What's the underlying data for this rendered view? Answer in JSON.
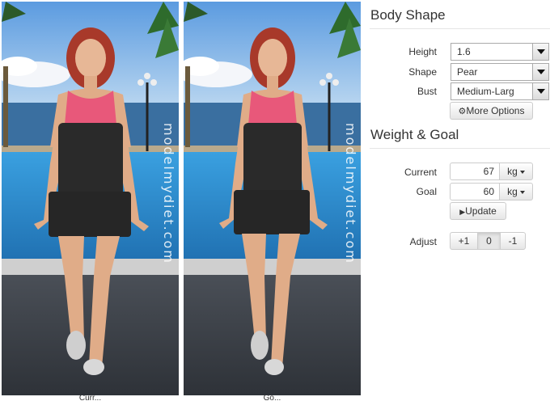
{
  "models": {
    "current": {
      "caption": "Curr...",
      "watermark": "modelmydiet.com"
    },
    "goal": {
      "caption": "Go...",
      "watermark": "modelmydiet.com"
    }
  },
  "body_shape": {
    "title": "Body Shape",
    "height": {
      "label": "Height",
      "value": "1.6"
    },
    "shape": {
      "label": "Shape",
      "value": "Pear"
    },
    "bust": {
      "label": "Bust",
      "value": "Medium-Larg"
    },
    "more_options": "More Options",
    "more_options_icon": "gear-icon"
  },
  "weight_goal": {
    "title": "Weight & Goal",
    "current": {
      "label": "Current",
      "value": "67",
      "unit": "kg"
    },
    "goal": {
      "label": "Goal",
      "value": "60",
      "unit": "kg"
    },
    "update_label": "Update",
    "update_icon": "play-icon"
  },
  "adjust": {
    "label": "Adjust",
    "options": [
      "+1",
      "0",
      "-1"
    ],
    "selected": "0"
  },
  "colors": {
    "top_pink": "#e8587a",
    "shorts": "#2a2a2a",
    "hair": "#a8392a",
    "sky": "#7fb4e0",
    "pool": "#2f8fd0"
  }
}
